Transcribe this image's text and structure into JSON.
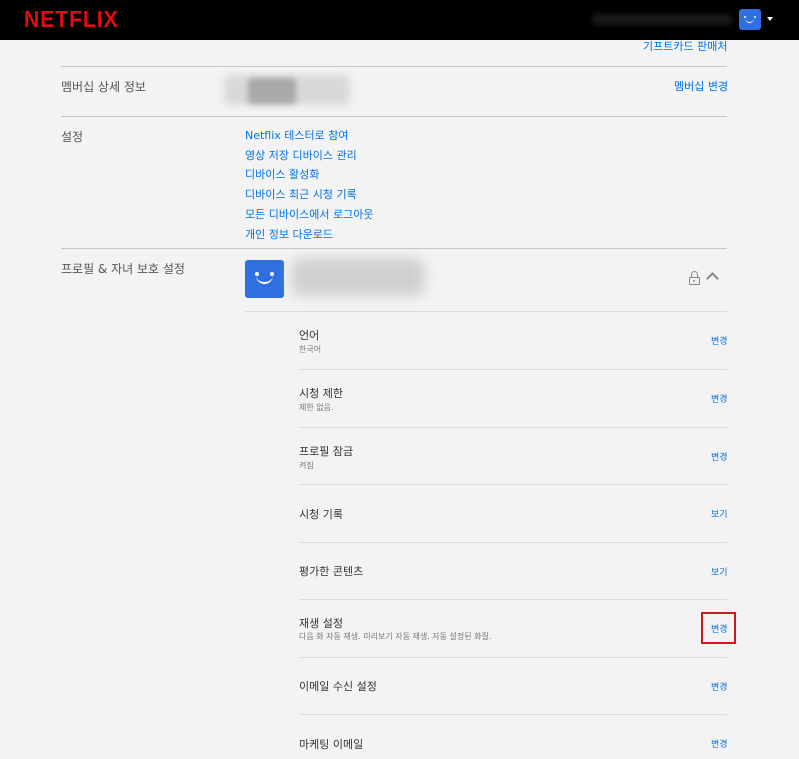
{
  "header": {
    "logo": "NETFLIX",
    "profile_icon": "smiley-profile-icon",
    "menu_icon": "caret-down-icon"
  },
  "membership": {
    "gift_card_link": "기프트카드 판매처",
    "label": "멤버십 상세 정보",
    "change_link": "멤버십 변경"
  },
  "settings": {
    "label": "설정",
    "links": [
      "Netflix 테스터로 참여",
      "영상 저장 디바이스 관리",
      "디바이스 활성화",
      "디바이스 최근 시청 기록",
      "모든 디바이스에서 로그아웃",
      "개인 정보 다운로드"
    ]
  },
  "profile": {
    "section_label": "프로필 & 자녀 보호 설정",
    "lock_icon": "lock-icon",
    "collapse_icon": "chevron-up-icon",
    "items": [
      {
        "title": "언어",
        "subtitle": "한국어",
        "action": "변경"
      },
      {
        "title": "시청 제한",
        "subtitle": "제한 없음.",
        "action": "변경"
      },
      {
        "title": "프로필 잠금",
        "subtitle": "켜짐",
        "action": "변경"
      },
      {
        "title": "시청 기록",
        "subtitle": "",
        "action": "보기"
      },
      {
        "title": "평가한 콘텐츠",
        "subtitle": "",
        "action": "보기"
      },
      {
        "title": "재생 설정",
        "subtitle": "다음 화 자동 재생. 미리보기 자동 재생. 자동 설정된 화질.",
        "action": "변경"
      },
      {
        "title": "이메일 수신 설정",
        "subtitle": "",
        "action": "변경"
      },
      {
        "title": "마케팅 이메일",
        "subtitle": "",
        "action": "변경"
      }
    ]
  },
  "colors": {
    "brand": "#e50914",
    "link": "#0073e6",
    "highlight": "#d0161f",
    "avatar": "#2f6fe0"
  }
}
